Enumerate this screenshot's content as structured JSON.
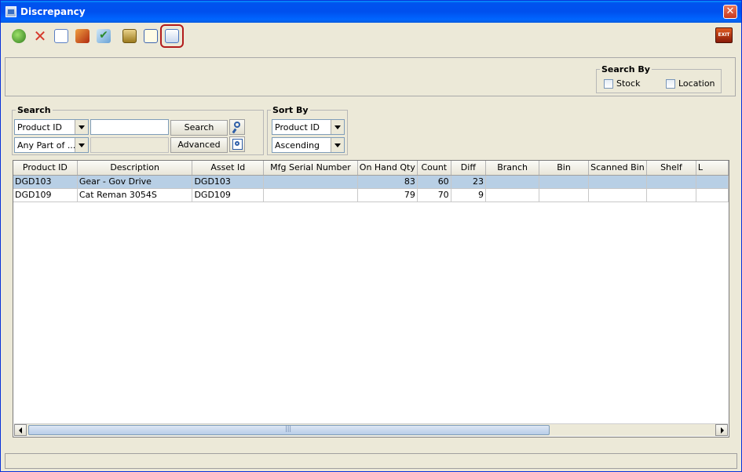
{
  "window": {
    "title": "Discrepancy"
  },
  "toolbar": {
    "buttons": [
      {
        "icon": "refresh-icon",
        "color": "#3d8f2a"
      },
      {
        "icon": "delete-icon",
        "color": "#d63a2c"
      },
      {
        "icon": "print-preview-icon",
        "color": "#5a7fc4"
      },
      {
        "icon": "scan-icon",
        "color": "#c44f1e"
      },
      {
        "icon": "check-icon",
        "color": "#3b9a43"
      },
      {
        "icon": "report-icon",
        "color": "#7a9a2a"
      },
      {
        "icon": "notes-icon",
        "color": "#3f66b0"
      },
      {
        "icon": "print-icon",
        "color": "#4a78c0"
      }
    ],
    "exit_label": "EXIT"
  },
  "search_by": {
    "legend": "Search By",
    "options": [
      "Stock",
      "Location"
    ]
  },
  "search": {
    "legend": "Search",
    "field_select": "Product ID",
    "match_select": "Any Part of ...",
    "search_value": "",
    "search_button": "Search",
    "advanced_button": "Advanced"
  },
  "sort_by": {
    "legend": "Sort By",
    "field": "Product ID",
    "order": "Ascending"
  },
  "grid": {
    "columns": [
      "Product ID",
      "Description",
      "Asset Id",
      "Mfg Serial Number",
      "On Hand Qty",
      "Count",
      "Diff",
      "Branch",
      "Bin",
      "Scanned Bin",
      "Shelf",
      "L"
    ],
    "rows": [
      [
        "DGD103",
        "Gear - Gov Drive",
        "DGD103",
        "",
        "83",
        "60",
        "23",
        "",
        "",
        "",
        "",
        ""
      ],
      [
        "DGD109",
        "Cat Reman 3054S",
        "DGD109",
        "",
        "79",
        "70",
        "9",
        "",
        "",
        "",
        "",
        ""
      ]
    ],
    "selected_row": 0
  },
  "status": {
    "text": ""
  }
}
